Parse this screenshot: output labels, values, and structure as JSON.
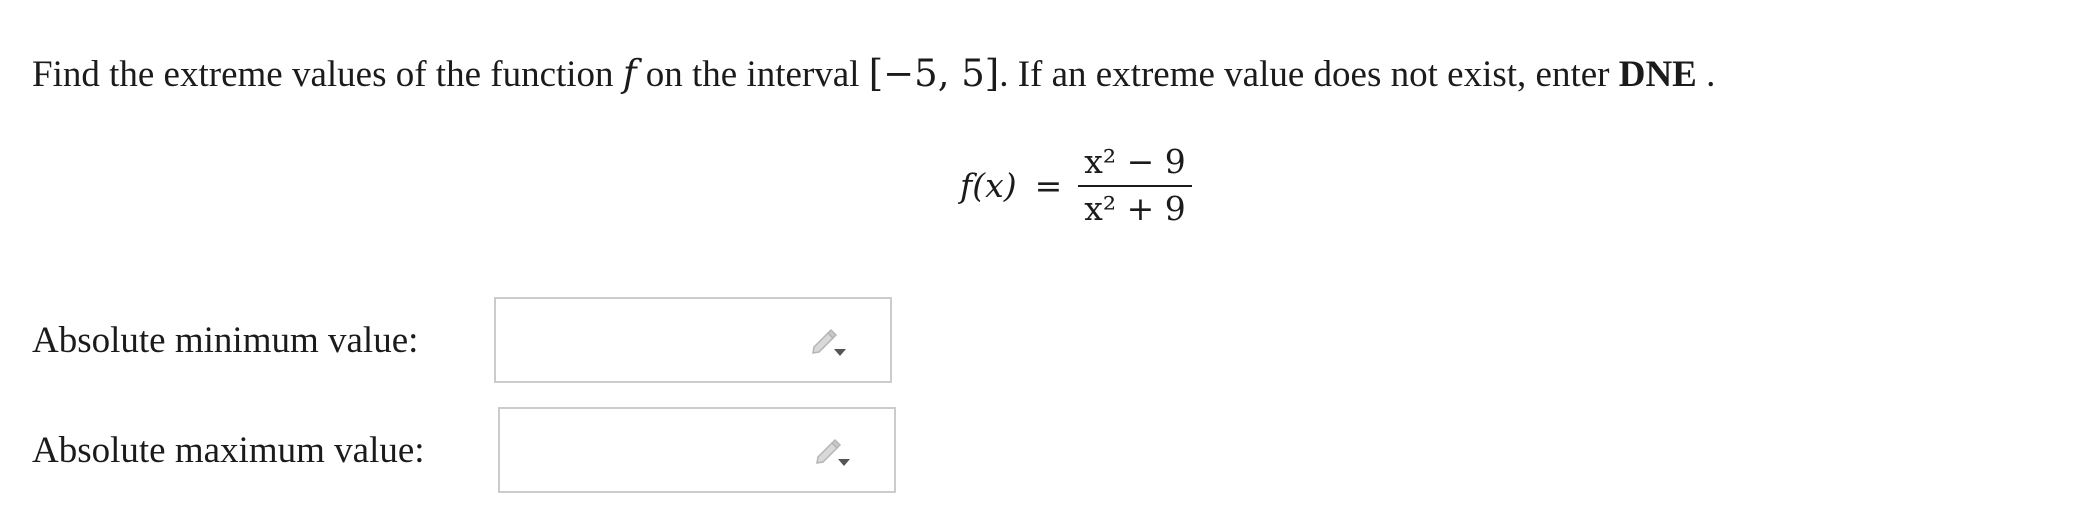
{
  "question": {
    "text_before_f": "Find the extreme values of the function",
    "func_symbol": "f",
    "text_on_the_interval": "on the interval",
    "interval": "[−5, 5]",
    "text_if": ". If an extreme value does not exist, enter",
    "dne": "DNE",
    "period": "."
  },
  "equation": {
    "lhs": "f(x)",
    "equals": "=",
    "numerator": "x² − 9",
    "denominator": "x² + 9"
  },
  "answers": [
    {
      "label": "Absolute minimum value:",
      "value": "",
      "icon": "pencil-dropdown-icon"
    },
    {
      "label": "Absolute maximum value:",
      "value": "",
      "icon": "pencil-dropdown-icon"
    }
  ]
}
